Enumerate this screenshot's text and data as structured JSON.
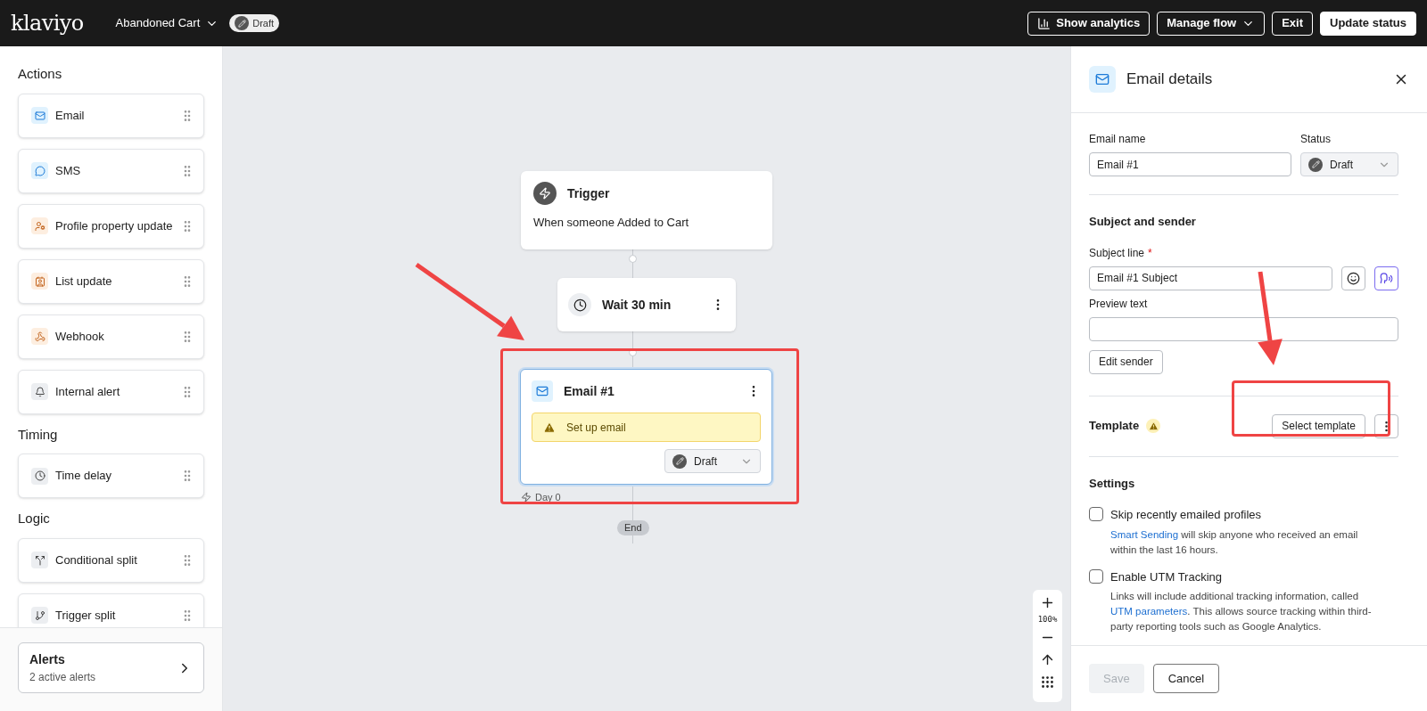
{
  "topbar": {
    "logo": "klaviyo",
    "flow_name": "Abandoned Cart",
    "flow_status": "Draft",
    "buttons": [
      {
        "label": "Show analytics",
        "kind": "analytics"
      },
      {
        "label": "Manage flow",
        "kind": "dropdown"
      },
      {
        "label": "Exit",
        "kind": "plain"
      },
      {
        "label": "Update status",
        "kind": "primary"
      }
    ]
  },
  "sidebar": {
    "sections": [
      {
        "title": "Actions",
        "items": [
          {
            "label": "Email",
            "kind": "email"
          },
          {
            "label": "SMS",
            "kind": "sms"
          },
          {
            "label": "Profile property update",
            "kind": "profile"
          },
          {
            "label": "List update",
            "kind": "list"
          },
          {
            "label": "Webhook",
            "kind": "webhook"
          },
          {
            "label": "Internal alert",
            "kind": "alert"
          }
        ]
      },
      {
        "title": "Timing",
        "items": [
          {
            "label": "Time delay",
            "kind": "delay"
          }
        ]
      },
      {
        "title": "Logic",
        "items": [
          {
            "label": "Conditional split",
            "kind": "conditional"
          },
          {
            "label": "Trigger split",
            "kind": "trigger"
          }
        ]
      }
    ],
    "alerts": {
      "title": "Alerts",
      "subtitle": "2 active alerts"
    }
  },
  "canvas": {
    "trigger": {
      "title": "Trigger",
      "description": "When someone Added to Cart"
    },
    "wait": {
      "title": "Wait 30 min"
    },
    "email": {
      "title": "Email #1",
      "warning": "Set up email",
      "status": "Draft",
      "selected": true
    },
    "day": "Day 0",
    "end": "End",
    "zoom": "100%"
  },
  "panel": {
    "title": "Email details",
    "email_name": {
      "label": "Email name",
      "value": "Email #1"
    },
    "status": {
      "label": "Status",
      "value": "Draft"
    },
    "subject_section": {
      "title": "Subject and sender",
      "subject_label": "Subject line",
      "required_mark": "*",
      "subject_value": "Email #1 Subject",
      "preview_label": "Preview text",
      "edit_sender": "Edit sender"
    },
    "template": {
      "title": "Template",
      "warning": true,
      "button": "Select template"
    },
    "settings": {
      "title": "Settings",
      "options": [
        {
          "label": "Skip recently emailed profiles",
          "checked": false,
          "description": [
            {
              "kind": "link",
              "text": "Smart Sending"
            },
            {
              "kind": "text",
              "text": " will skip anyone who received an email within the last 16 hours."
            }
          ]
        },
        {
          "label": "Enable UTM Tracking",
          "checked": false,
          "description": [
            {
              "kind": "text",
              "text": "Links will include additional tracking information, called "
            },
            {
              "kind": "link",
              "text": "UTM parameters"
            },
            {
              "kind": "text",
              "text": ". This allows source tracking within third-party reporting tools such as Google Analytics."
            }
          ]
        }
      ]
    },
    "footer": {
      "save": {
        "label": "Save",
        "disabled": true
      },
      "cancel": "Cancel"
    }
  }
}
